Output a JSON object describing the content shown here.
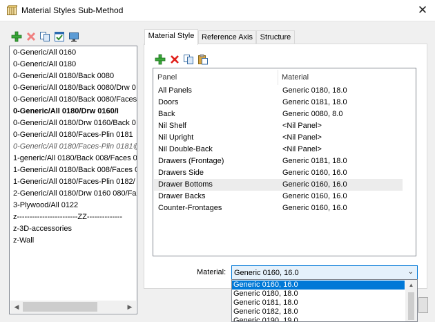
{
  "window": {
    "title": "Material Styles Sub-Method",
    "close_glyph": "✕",
    "app_icon": "cabinet-icon"
  },
  "list_toolbar": [
    "add-icon",
    "delete-icon",
    "copy-icon",
    "properties-icon",
    "monitor-icon"
  ],
  "styles_list": {
    "items": [
      {
        "label": "0-Generic/All 0160",
        "style": "normal"
      },
      {
        "label": "0-Generic/All 0180",
        "style": "normal"
      },
      {
        "label": "0-Generic/All 0180/Back 0080",
        "style": "normal"
      },
      {
        "label": "0-Generic/All 0180/Back 0080/Drw 0",
        "style": "normal"
      },
      {
        "label": "0-Generic/All 0180/Back 0080/Faces",
        "style": "normal"
      },
      {
        "label": "0-Generic/All 0180/Drw 0160/I",
        "style": "bold"
      },
      {
        "label": "0-Generic/All 0180/Drw 0160/Back 0",
        "style": "normal"
      },
      {
        "label": "0-Generic/All 0180/Faces-Plin 0181",
        "style": "normal"
      },
      {
        "label": "0-Generic/All 0180/Faces-Plin 0181@",
        "style": "italic"
      },
      {
        "label": "1-generic/All 0180/Back 008/Faces 0",
        "style": "normal"
      },
      {
        "label": "1-Generic/All 0180/Back 008/Faces 0",
        "style": "normal"
      },
      {
        "label": "1-Generic/All 0180/Faces-Plin 0182/",
        "style": "normal"
      },
      {
        "label": "2-Generic/All 0180/Drw 0160 080/Fa",
        "style": "normal"
      },
      {
        "label": "3-Plywood/All 0122",
        "style": "normal"
      },
      {
        "label": "z------------------------ZZ--------------",
        "style": "normal"
      },
      {
        "label": "z-3D-accessories",
        "style": "normal"
      },
      {
        "label": "z-Wall",
        "style": "normal"
      }
    ]
  },
  "tabs": [
    {
      "label": "Material Style",
      "active": true
    },
    {
      "label": "Reference Axis",
      "active": false
    },
    {
      "label": "Structure",
      "active": false
    }
  ],
  "grid_toolbar": [
    "add-icon",
    "delete-icon",
    "copy-icon",
    "paste-icon"
  ],
  "grid": {
    "columns": [
      "Panel",
      "Material"
    ],
    "rows": [
      {
        "panel": "All Panels",
        "material": "Generic 0180, 18.0"
      },
      {
        "panel": "Doors",
        "material": "Generic 0181, 18.0"
      },
      {
        "panel": "Back",
        "material": "Generic 0080, 8.0"
      },
      {
        "panel": "Nil Shelf",
        "material": "<Nil Panel>"
      },
      {
        "panel": "Nil Upright",
        "material": "<Nil Panel>"
      },
      {
        "panel": "Nil Double-Back",
        "material": "<Nil Panel>"
      },
      {
        "panel": "Drawers (Frontage)",
        "material": "Generic 0181, 18.0"
      },
      {
        "panel": "Drawers Side",
        "material": "Generic 0160, 16.0"
      },
      {
        "panel": "Drawer Bottoms",
        "material": "Generic 0160, 16.0",
        "selected": true
      },
      {
        "panel": "Drawer Backs",
        "material": "Generic 0160, 16.0"
      },
      {
        "panel": "Counter-Frontages",
        "material": "Generic 0160, 16.0"
      }
    ]
  },
  "material": {
    "label": "Material:",
    "value": "Generic 0160, 16.0",
    "options": [
      {
        "label": "Generic 0160, 16.0",
        "selected": true
      },
      {
        "label": "Generic 0180, 18.0",
        "selected": false
      },
      {
        "label": "Generic 0181, 18.0",
        "selected": false
      },
      {
        "label": "Generic 0182, 18.0",
        "selected": false
      },
      {
        "label": "Generic 0190, 19.0",
        "selected": false
      }
    ]
  }
}
